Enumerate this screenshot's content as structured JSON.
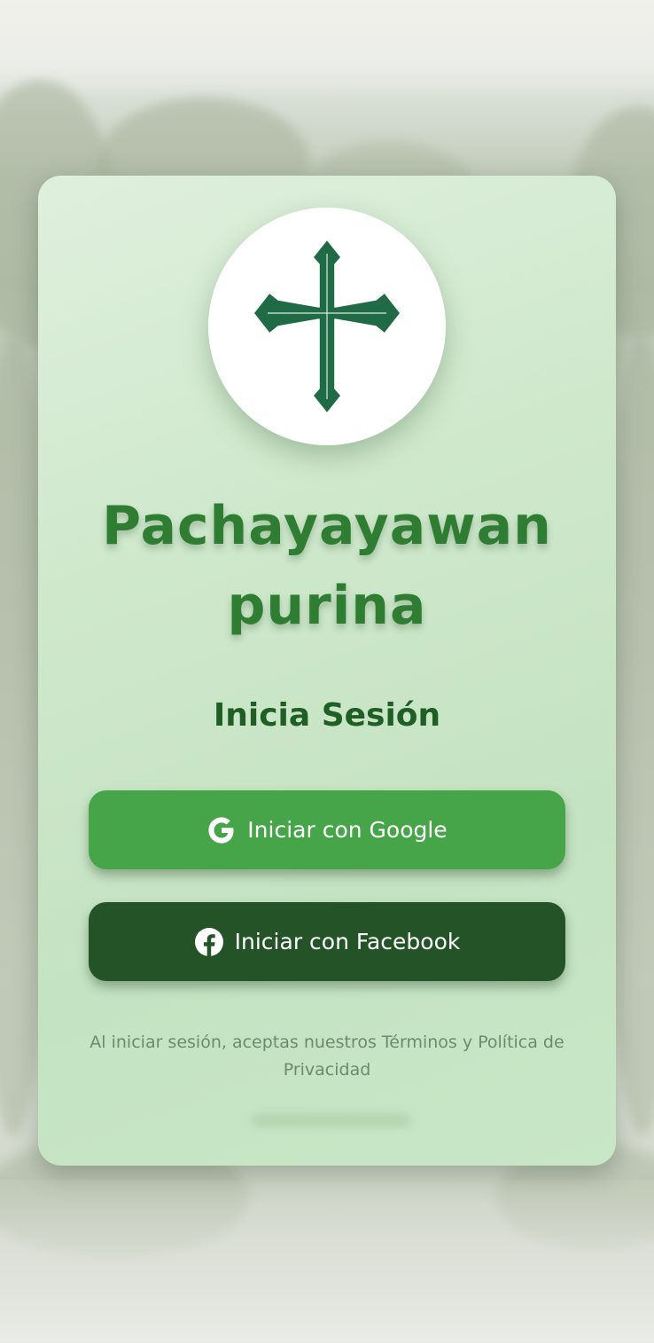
{
  "app": {
    "title_line1": "Pachayayawan",
    "title_line2": "purina",
    "logo_icon": "cross-icon"
  },
  "login": {
    "heading": "Inicia Sesión",
    "google_label": "Iniciar con Google",
    "google_icon": "google-icon",
    "facebook_label": "Iniciar con Facebook",
    "facebook_icon": "facebook-icon",
    "legal_text": "Al iniciar sesión, aceptas nuestros Términos y Política de Privacidad"
  },
  "colors": {
    "brand_green": "#2e7d32",
    "google_button": "#46a548",
    "facebook_button": "#235326",
    "cross": "#1f6b45"
  }
}
